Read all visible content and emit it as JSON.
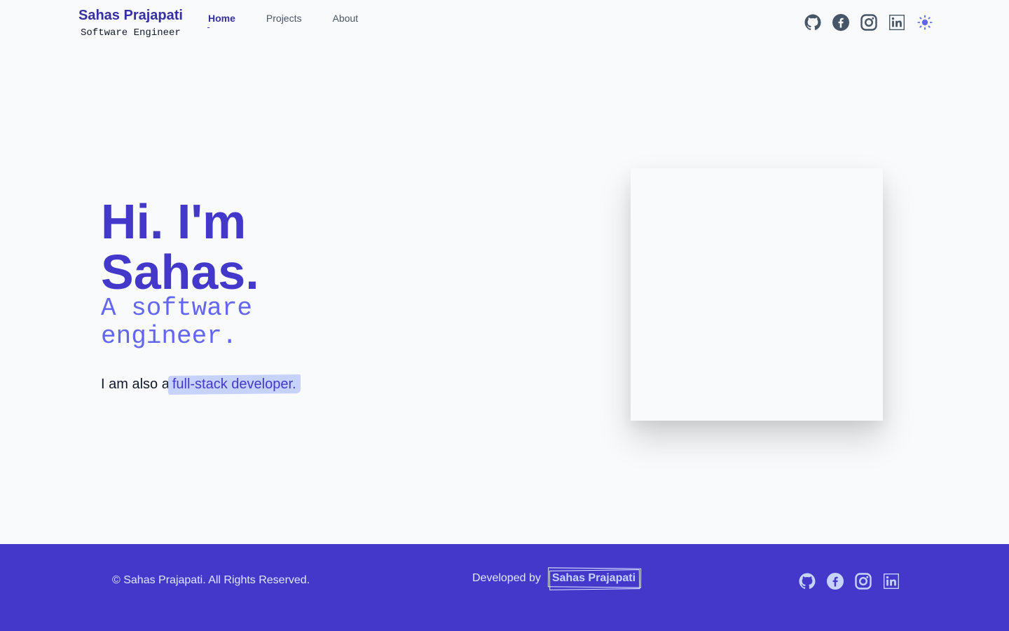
{
  "header": {
    "brand_name": "Sahas Prajapati",
    "brand_subtitle": "Software Engineer",
    "nav": [
      {
        "label": "Home",
        "active": true
      },
      {
        "label": "Projects",
        "active": false
      },
      {
        "label": "About",
        "active": false
      }
    ],
    "icons": [
      "github-icon",
      "facebook-icon",
      "instagram-icon",
      "linkedin-icon",
      "sun-theme-icon"
    ]
  },
  "hero": {
    "title_line1": "Hi. I'm",
    "title_line2": "Sahas.",
    "subtitle_line1": "A software",
    "subtitle_line2": "engineer.",
    "line_prefix": "I am also a",
    "line_highlight": "full-stack developer."
  },
  "footer": {
    "copyright": "© Sahas Prajapati. All Rights Reserved.",
    "developed_by_label": "Developed by",
    "developer_name": "Sahas Prajapati",
    "icons": [
      "github-icon",
      "facebook-icon",
      "instagram-icon",
      "linkedin-icon"
    ]
  },
  "colors": {
    "background": "#f8fafc",
    "primary": "#4338ca",
    "primary_dark": "#3730a3",
    "accent": "#6366f1",
    "highlight": "#c7d2fe",
    "footer_bg": "#4338ca",
    "icon_gray": "#475569"
  }
}
